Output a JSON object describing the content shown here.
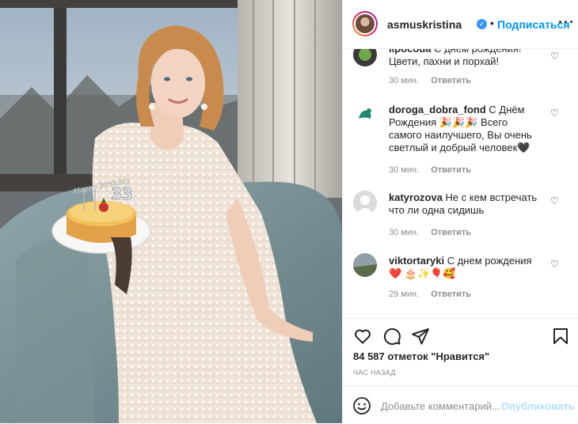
{
  "header": {
    "username": "asmuskristina",
    "verified_mark": "✓",
    "separator": "•",
    "follow_label": "Подписаться",
    "more_label": "···"
  },
  "comments": [
    {
      "user": "lipocoda",
      "text": "С днем рождения! Цвети, пахни и порхай!",
      "time": "30 мин.",
      "reply_label": "Ответить",
      "avatar_colors": [
        "#3a3a3a",
        "#6fa84a"
      ]
    },
    {
      "user": "doroga_dobra_fond",
      "text": "С Днём Рождения 🎉🎉🎉 Всего самого наилучшего, Вы очень светлый и добрый человек🖤",
      "time": "30 мин.",
      "reply_label": "Ответить",
      "avatar_colors": [
        "#ffffff",
        "#1f8a70"
      ]
    },
    {
      "user": "katyrozova",
      "text": "Не с кем встречать что ли одна сидишь",
      "time": "30 мин.",
      "reply_label": "Ответить",
      "avatar_colors": [
        "#dbdbdb",
        "#ffffff"
      ]
    },
    {
      "user": "viktortaryki",
      "text": "С днем рождения❤️ 🎂✨🎈🥰",
      "time": "29 мин.",
      "reply_label": "Ответить",
      "avatar_colors": [
        "#8fa0a6",
        "#5c6b4a"
      ]
    }
  ],
  "actions": {
    "like_icon": "heart-icon",
    "comment_icon": "comment-icon",
    "share_icon": "paper-plane-icon",
    "save_icon": "bookmark-icon",
    "likes_text": "84 587 отметок \"Нравится\"",
    "timestamp": "ЧАС НАЗАД"
  },
  "add_comment": {
    "placeholder": "Добавьте комментарий...",
    "publish_label": "Опубликовать",
    "emoji_icon": "smiley-icon"
  },
  "photo": {
    "topper_text": "Happy Birthday",
    "candle_number": "33"
  },
  "colors": {
    "accent": "#0095f6",
    "publish_disabled": "#b2dffc",
    "muted": "#8e8e8e",
    "text": "#262626",
    "border": "#efefef"
  }
}
